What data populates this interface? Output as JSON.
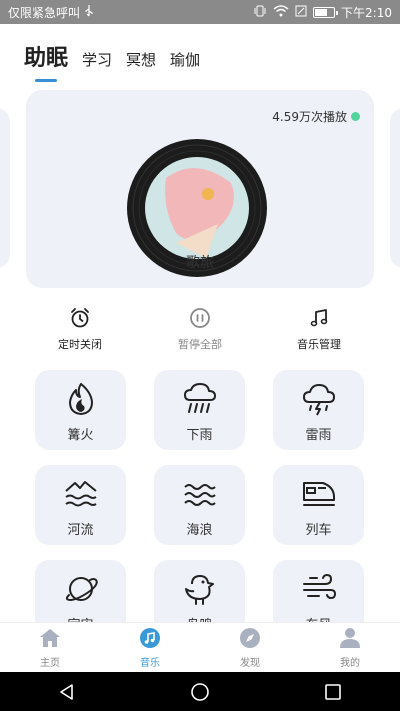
{
  "status_bar": {
    "left_text": "仅限紧急呼叫",
    "time": "下午2:10",
    "battery_level": 0.6
  },
  "tabs": [
    {
      "label": "助眠",
      "active": true
    },
    {
      "label": "学习",
      "active": false
    },
    {
      "label": "冥想",
      "active": false
    },
    {
      "label": "瑜伽",
      "active": false
    }
  ],
  "music_card": {
    "plays": "4.59万次播放",
    "title": "歌旅"
  },
  "controls": {
    "timer_label": "定时关闭",
    "pause_all_label": "暂停全部",
    "manage_label": "音乐管理"
  },
  "sounds": [
    {
      "label": "篝火",
      "icon": "fire-icon"
    },
    {
      "label": "下雨",
      "icon": "rain-icon"
    },
    {
      "label": "雷雨",
      "icon": "thunderstorm-icon"
    },
    {
      "label": "河流",
      "icon": "river-icon"
    },
    {
      "label": "海浪",
      "icon": "waves-icon"
    },
    {
      "label": "列车",
      "icon": "train-icon"
    },
    {
      "label": "宇宙",
      "icon": "planet-icon"
    },
    {
      "label": "鸟鸣",
      "icon": "bird-icon"
    },
    {
      "label": "东风",
      "icon": "wind-icon"
    }
  ],
  "bottom_nav": [
    {
      "label": "主页",
      "active": false
    },
    {
      "label": "音乐",
      "active": true
    },
    {
      "label": "发现",
      "active": false
    },
    {
      "label": "我的",
      "active": false
    }
  ],
  "colors": {
    "accent": "#3a9ad9",
    "card_bg": "#eef1f8",
    "status_bar": "#8a8a8a"
  }
}
